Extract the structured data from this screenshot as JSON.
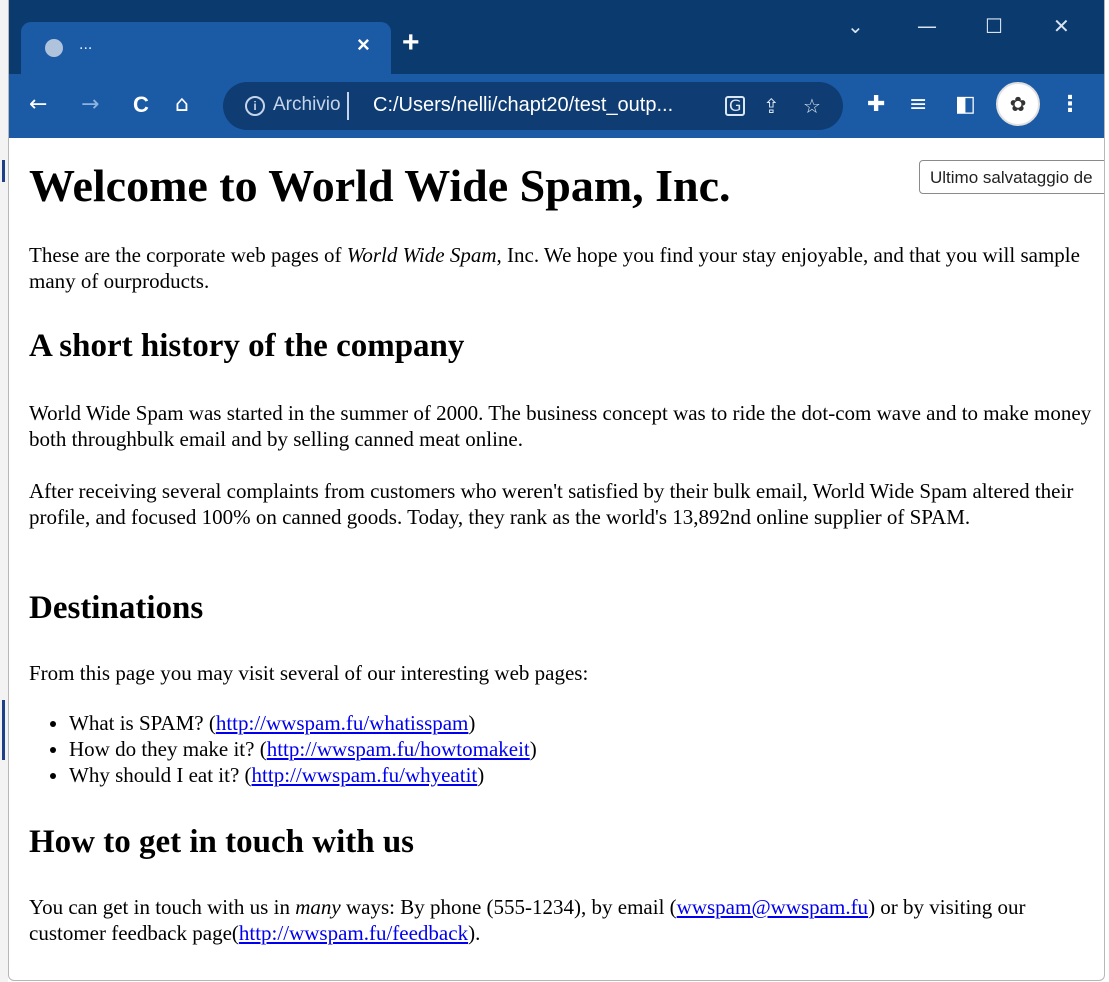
{
  "browser": {
    "tab": {
      "title": "...",
      "close_label": "×"
    },
    "new_tab_label": "+",
    "window_controls": {
      "dropdown": "⌄",
      "minimize": "—",
      "maximize": "☐",
      "close": "✕"
    },
    "toolbar": {
      "back": "←",
      "forward": "→",
      "reload": "C",
      "home": "⌂"
    },
    "omnibox": {
      "security_label": "Archivio",
      "url": "C:/Users/nelli/chapt20/test_outp..."
    },
    "colors": {
      "titlebar": "#0b3a6e",
      "toolbar": "#1b5ba6",
      "omnibox": "#0e3c73"
    }
  },
  "tooltip": {
    "text": "Ultimo salvataggio de"
  },
  "page": {
    "h1": "Welcome to World Wide Spam, Inc.",
    "intro": {
      "before": "These are the corporate web pages of ",
      "em": "World Wide Spam",
      "after": ", Inc. We hope you find your stay enjoyable, and that you will sample many of ourproducts."
    },
    "history_heading": "A short history of the company",
    "history_p1": "World Wide Spam was started in the summer of 2000. The business concept was to ride the dot-com wave and to make money both throughbulk email and by selling canned meat online.",
    "history_p2": "After receiving several complaints from customers who weren't satisfied by their bulk email, World Wide Spam altered their profile, and focused 100% on canned goods. Today, they rank as the world's 13,892nd online supplier of SPAM.",
    "destinations_heading": "Destinations",
    "destinations_intro": "From this page you may visit several of our interesting web pages:",
    "links": [
      {
        "text": "What is SPAM? (",
        "url": "http://wwspam.fu/whatisspam",
        "close": ")"
      },
      {
        "text": "How do they make it? (",
        "url": "http://wwspam.fu/howtomakeit",
        "close": ")"
      },
      {
        "text": "Why should I eat it? (",
        "url": "http://wwspam.fu/whyeatit",
        "close": ")"
      }
    ],
    "contact_heading": "How to get in touch with us",
    "contact": {
      "part1": "You can get in touch with us in ",
      "em": "many",
      "part2": " ways: By phone (555-1234), by email (",
      "email": "wwspam@wwspam.fu",
      "part3": ") or by visiting our customer feedback page(",
      "feedback_url": "http://wwspam.fu/feedback",
      "part4": ")."
    }
  }
}
